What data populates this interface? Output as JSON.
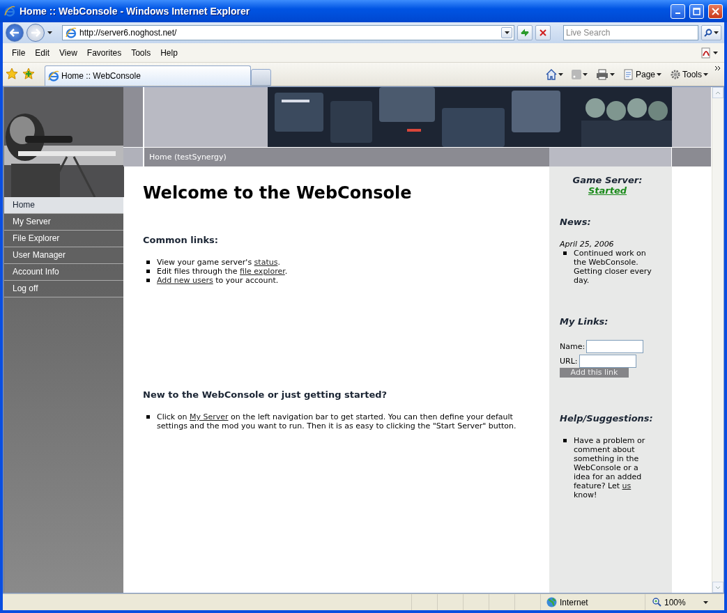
{
  "window": {
    "title": "Home :: WebConsole - Windows Internet Explorer"
  },
  "address_bar": {
    "url": "http://server6.noghost.net/",
    "search_placeholder": "Live Search"
  },
  "menu": [
    "File",
    "Edit",
    "View",
    "Favorites",
    "Tools",
    "Help"
  ],
  "tabs": [
    {
      "label": "Home :: WebConsole",
      "selected": true
    }
  ],
  "command_bar": [
    "Page",
    "Tools"
  ],
  "page": {
    "breadcrumb": "Home (testSynergy)",
    "nav": [
      {
        "label": "Home",
        "selected": true
      },
      {
        "label": "My Server",
        "selected": false
      },
      {
        "label": "File Explorer",
        "selected": false
      },
      {
        "label": "User Manager",
        "selected": false
      },
      {
        "label": "Account Info",
        "selected": false
      },
      {
        "label": "Log off",
        "selected": false
      }
    ],
    "heading": "Welcome to the WebConsole",
    "sections": [
      {
        "title": "Common links:",
        "items": [
          {
            "before": "View your game server's ",
            "link": "status",
            "after": "."
          },
          {
            "before": "Edit files through the ",
            "link": "file explorer",
            "after": "."
          },
          {
            "link": "Add new users",
            "after": " to your account."
          }
        ]
      },
      {
        "title": "New to the WebConsole or just getting started?",
        "items": [
          {
            "before": "Click on ",
            "link": "My Server",
            "after": " on the left navigation bar to get started. You can then define your default settings and the mod you want to run. Then it is as easy to clicking the \"Start Server\" button."
          }
        ]
      }
    ],
    "side": {
      "server_label": "Game Server:",
      "server_status": "Started",
      "news_title": "News:",
      "news": [
        {
          "date": "April 25, 2006",
          "items": [
            "Continued work on the WebConsole. Getting closer every day."
          ]
        }
      ],
      "links_title": "My Links:",
      "name_label": "Name:",
      "url_label": "URL:",
      "add_button": "Add this link",
      "help_title": "Help/Suggestions:",
      "help": {
        "before": "Have a problem or comment about something in the WebConsole or a idea for an added feature? Let ",
        "link": "us",
        "after": " know!"
      }
    }
  },
  "status_bar": {
    "zone": "Internet",
    "zoom": "100%"
  }
}
